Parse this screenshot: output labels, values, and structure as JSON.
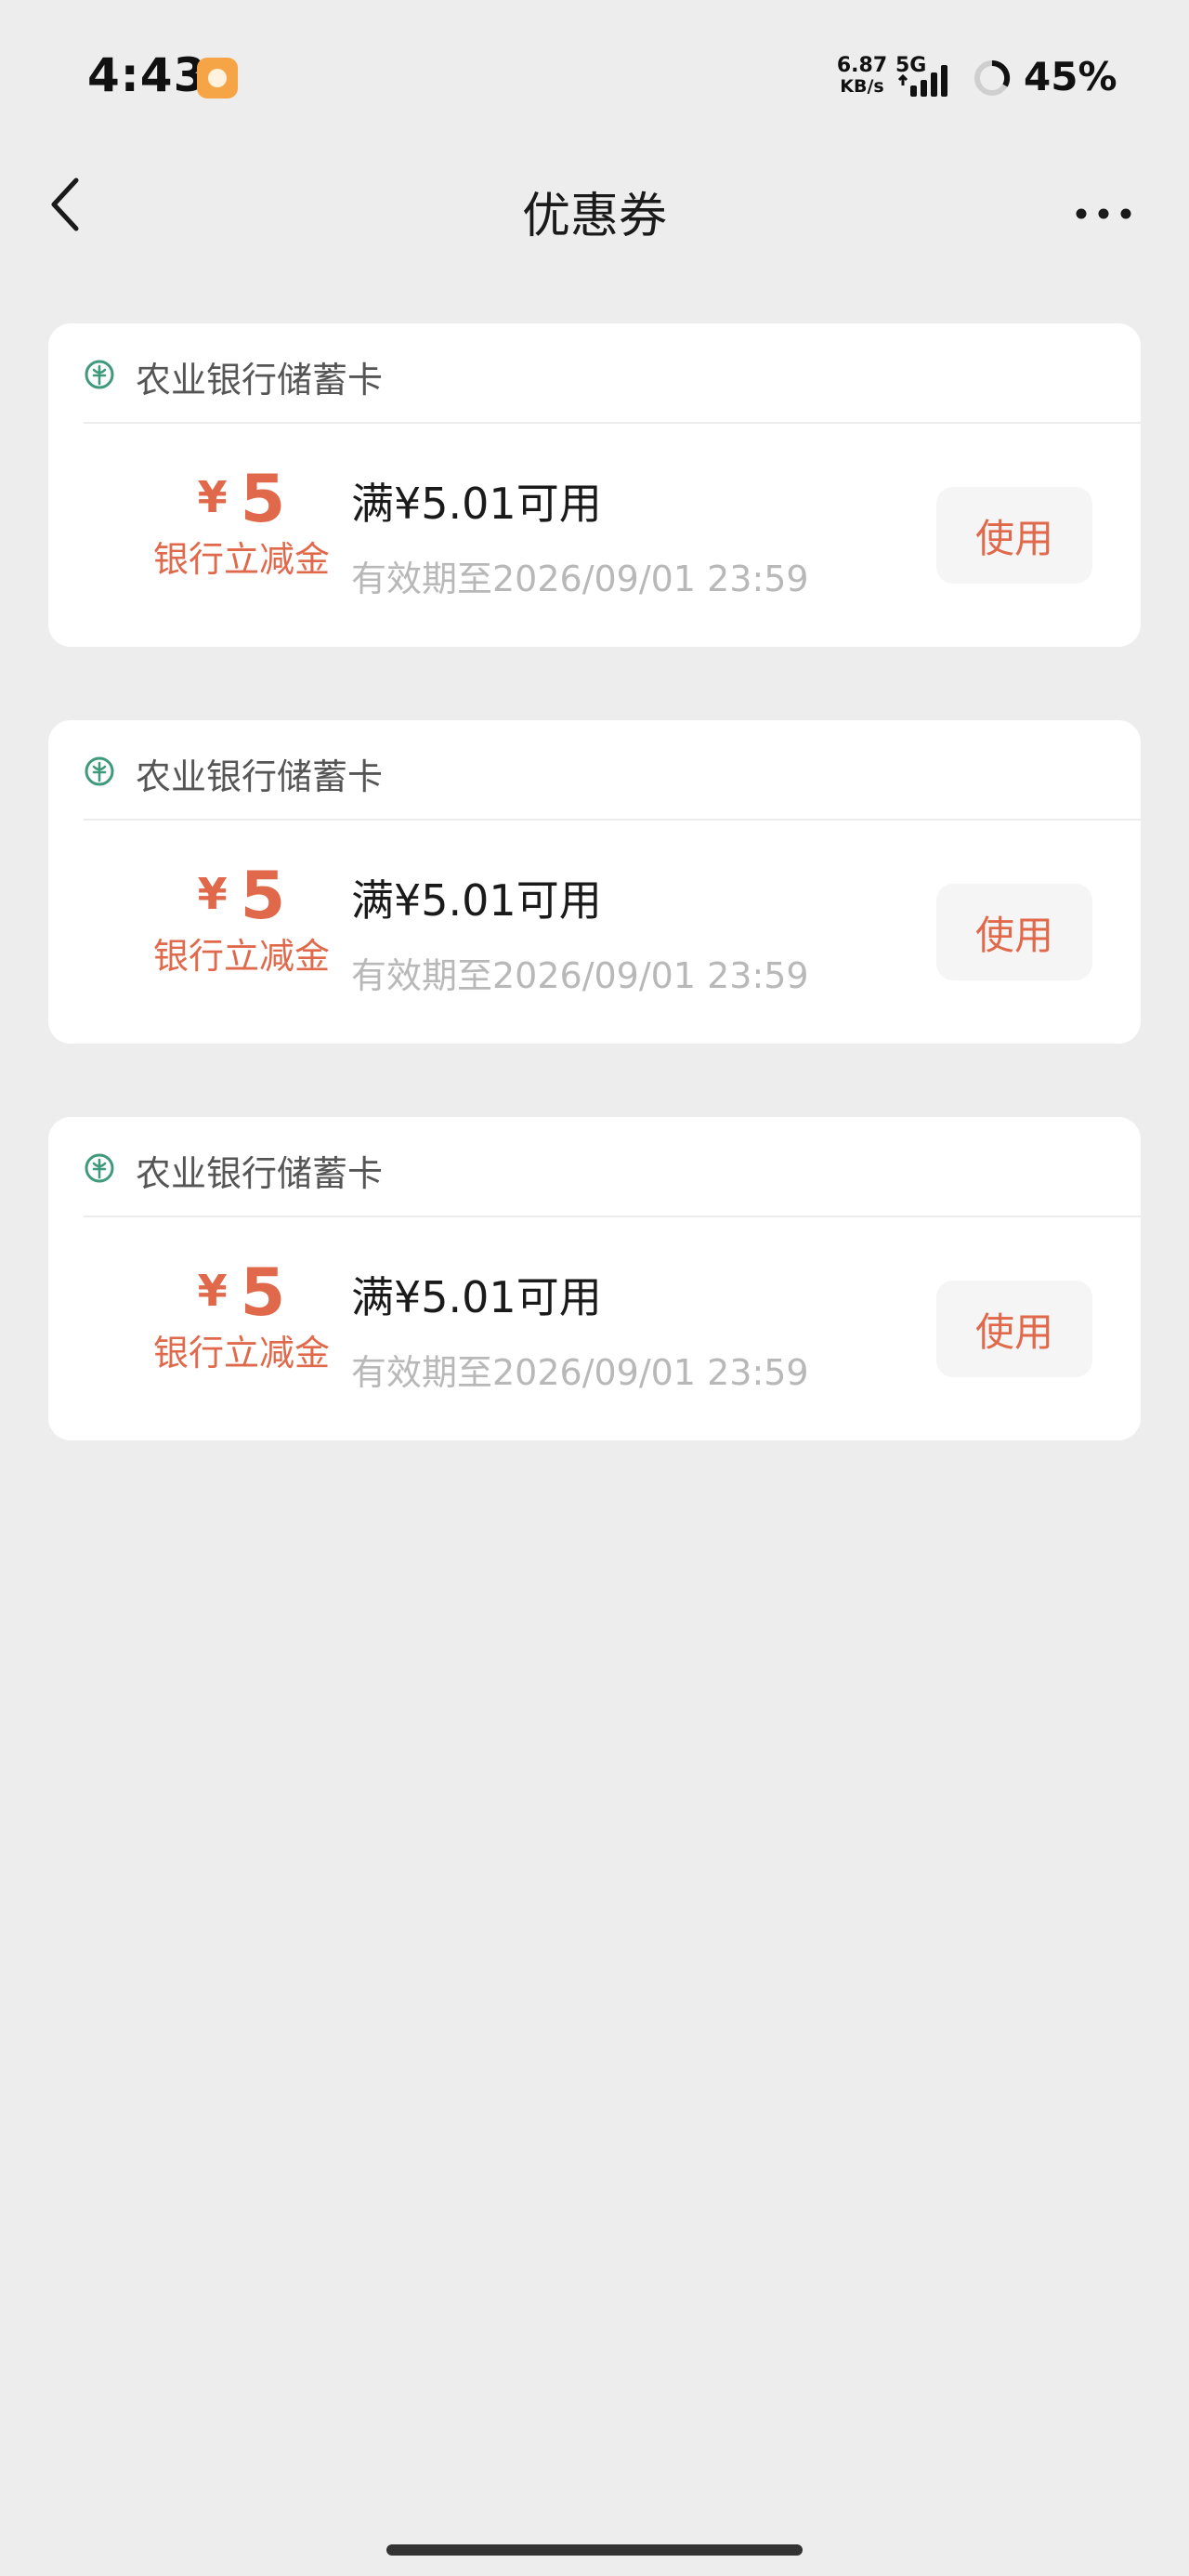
{
  "status_bar": {
    "time": "4:43",
    "net_speed_value": "6.87",
    "net_speed_unit": "KB/s",
    "network_type": "5G",
    "battery": "45%"
  },
  "header": {
    "title": "优惠券"
  },
  "coupons": [
    {
      "bank": "农业银行储蓄卡",
      "currency": "¥",
      "amount": "5",
      "type": "银行立减金",
      "condition": "满¥5.01可用",
      "validity": "有效期至2026/09/01 23:59",
      "button": "使用"
    },
    {
      "bank": "农业银行储蓄卡",
      "currency": "¥",
      "amount": "5",
      "type": "银行立减金",
      "condition": "满¥5.01可用",
      "validity": "有效期至2026/09/01 23:59",
      "button": "使用"
    },
    {
      "bank": "农业银行储蓄卡",
      "currency": "¥",
      "amount": "5",
      "type": "银行立减金",
      "condition": "满¥5.01可用",
      "validity": "有效期至2026/09/01 23:59",
      "button": "使用"
    }
  ],
  "colors": {
    "accent": "#e1694b",
    "background": "#ededed",
    "bank_icon": "#3f9a7c"
  },
  "icons": {
    "back": "chevron-left-icon",
    "more": "more-horizontal-icon",
    "bank": "agricultural-bank-logo-icon"
  }
}
